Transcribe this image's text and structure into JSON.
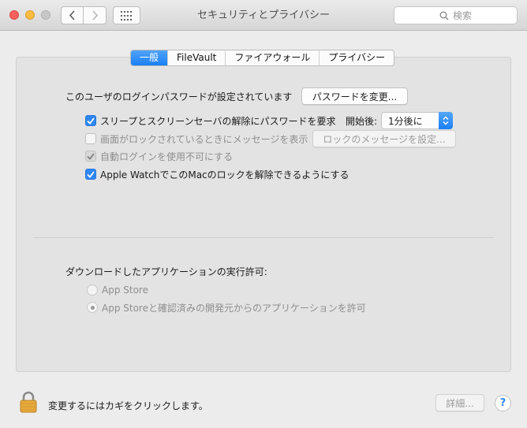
{
  "window": {
    "title": "セキュリティとプライバシー",
    "search_placeholder": "検索"
  },
  "tabs": [
    {
      "label": "一般",
      "active": true
    },
    {
      "label": "FileVault",
      "active": false
    },
    {
      "label": "ファイアウォール",
      "active": false
    },
    {
      "label": "プライバシー",
      "active": false
    }
  ],
  "general": {
    "password_text": "このユーザのログインパスワードが設定されています",
    "change_password_button": "パスワードを変更...",
    "require_password": {
      "label": "スリープとスクリーンセーバの解除にパスワードを要求",
      "checked": true
    },
    "start_label": "開始後:",
    "start_value": "1分後に",
    "show_message": {
      "label": "画面がロックされているときにメッセージを表示",
      "checked": false,
      "enabled": false
    },
    "set_message_button": "ロックのメッセージを設定...",
    "disable_auto_login": {
      "label": "自動ログインを使用不可にする",
      "checked": true,
      "enabled": false
    },
    "apple_watch": {
      "label": "Apple WatchでこのMacのロックを解除できるようにする",
      "checked": true
    }
  },
  "downloads": {
    "heading": "ダウンロードしたアプリケーションの実行許可:",
    "options": [
      {
        "label": "App Store",
        "selected": false
      },
      {
        "label": "App Storeと確認済みの開発元からのアプリケーションを許可",
        "selected": true
      }
    ]
  },
  "footer": {
    "lock_text": "変更するにはカギをクリックします。",
    "advanced_button": "詳細...",
    "help_glyph": "?"
  },
  "colors": {
    "accent": "#2f87f6",
    "close": "#fc605c",
    "minimize": "#fdbc40",
    "zoom_inactive": "#c7c7c7",
    "lock_body": "#e6a93a"
  },
  "icons": [
    "close-icon",
    "minimize-icon",
    "zoom-icon",
    "chevron-left-icon",
    "chevron-right-icon",
    "grid-icon",
    "search-icon",
    "checkmark-icon",
    "updown-arrows-icon",
    "lock-icon",
    "help-icon"
  ]
}
